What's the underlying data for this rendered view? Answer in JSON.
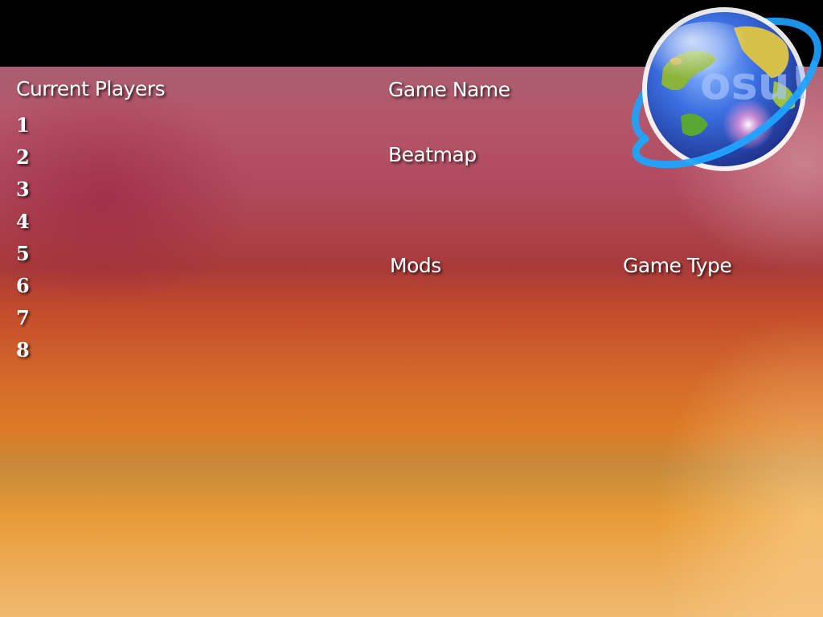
{
  "players": {
    "header": "Current Players",
    "slots": [
      "1",
      "2",
      "3",
      "4",
      "5",
      "6",
      "7",
      "8"
    ]
  },
  "game": {
    "name_label": "Game Name",
    "beatmap_label": "Beatmap",
    "mods_label": "Mods",
    "type_label": "Game Type"
  },
  "logo": {
    "text": "osu!",
    "icon": "osu-globe-icon"
  },
  "colors": {
    "top_bar": "#000000",
    "text": "#ffffff",
    "globe_ocean": "#2d64d8",
    "orbit_ring": "#1fa3ff"
  }
}
